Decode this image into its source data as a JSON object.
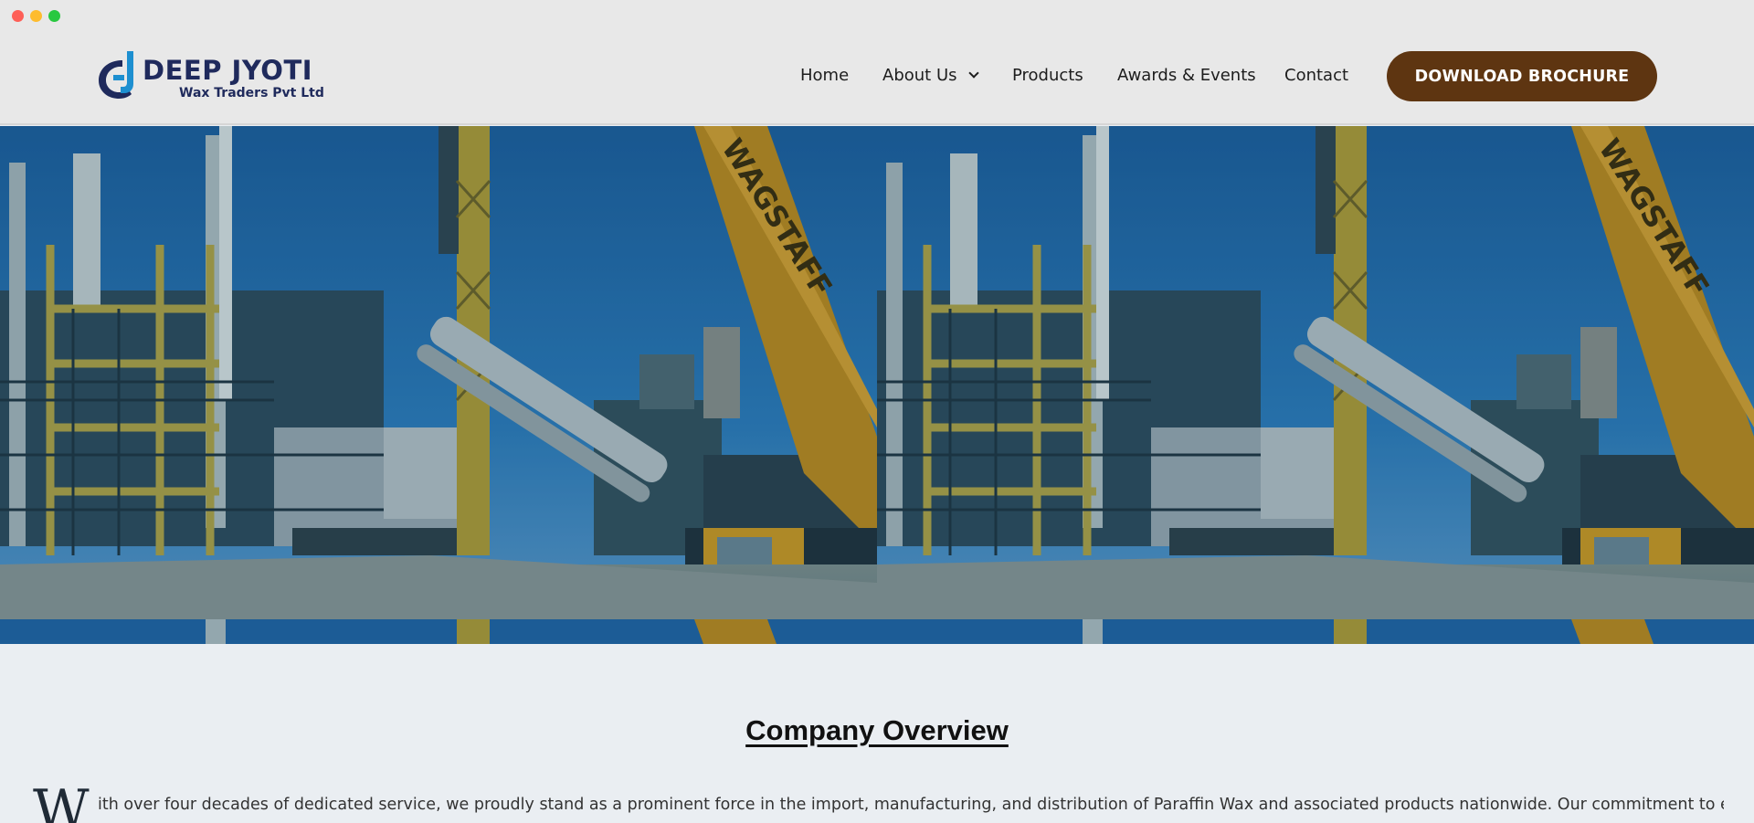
{
  "window": {
    "controls": [
      "close",
      "minimize",
      "zoom"
    ]
  },
  "brand": {
    "name": "DEEP JYOTI",
    "subtitle": "Wax Traders Pvt Ltd",
    "icon": "dj-logo-icon",
    "colors": {
      "navy": "#1f2a5c",
      "cyan": "#1d8fd0"
    }
  },
  "nav": {
    "items": [
      {
        "label": "Home"
      },
      {
        "label": "About Us",
        "has_dropdown": true
      },
      {
        "label": "Products"
      },
      {
        "label": "Awards & Events"
      },
      {
        "label": "Contact"
      }
    ],
    "cta": "DOWNLOAD BROCHURE",
    "cta_color": "#5e3511"
  },
  "hero": {
    "image": "industrial-refinery-crane-photo",
    "crane_text": "WAGSTAFF"
  },
  "overview": {
    "title": "Company Overview",
    "dropcap": "W",
    "line1": "ith over four decades of dedicated service, we proudly stand as a prominent force in the import, manufacturing, and distribution of Paraffin Wax and associated products nationwide. Our commitment to excellence"
  }
}
